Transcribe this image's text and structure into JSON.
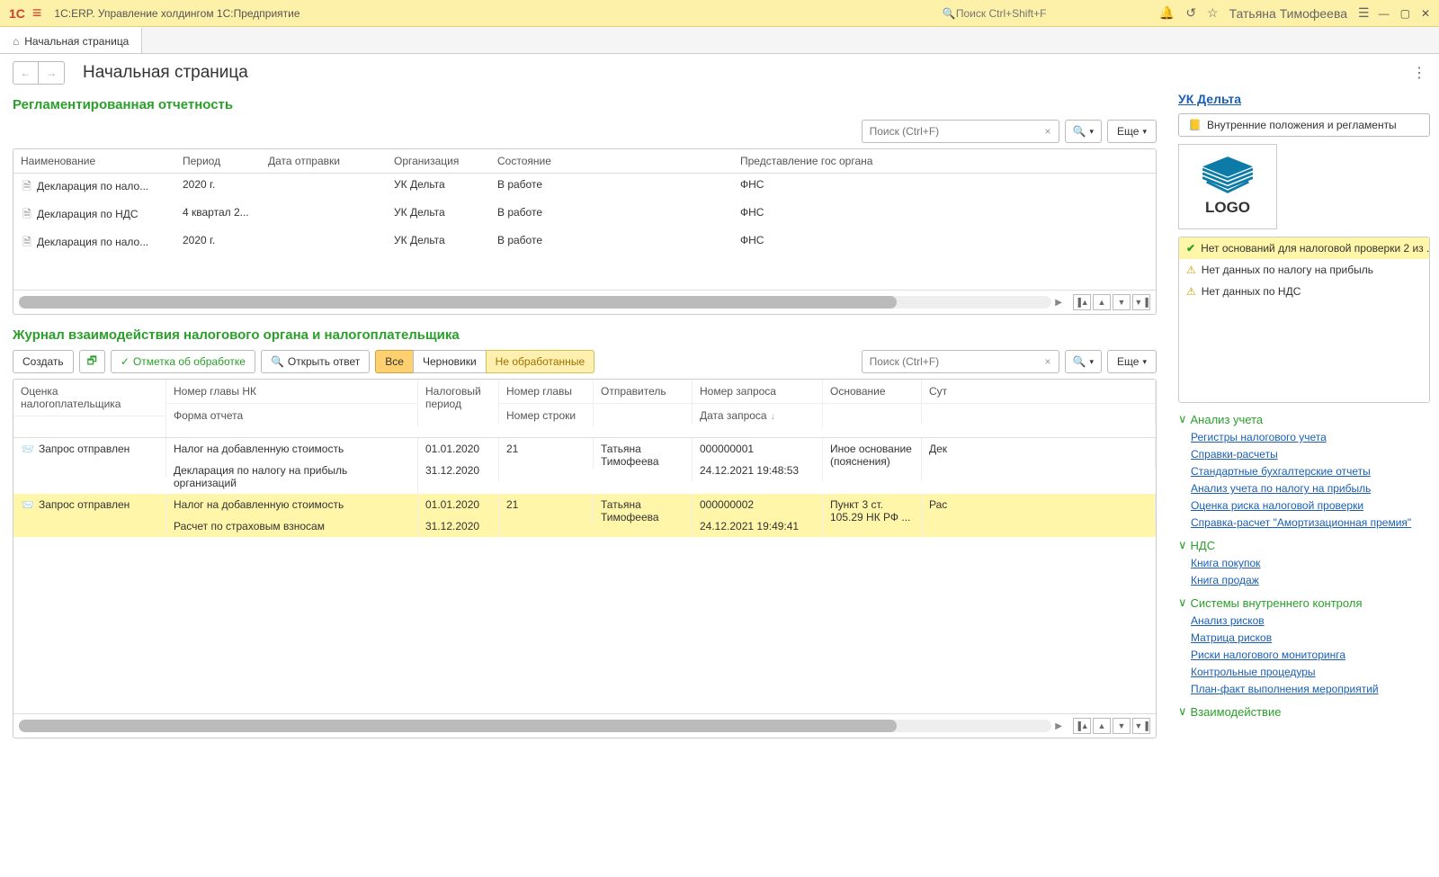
{
  "app": {
    "title": "1С:ERP. Управление холдингом 1С:Предприятие",
    "logo": "1С",
    "search_placeholder": "Поиск Ctrl+Shift+F",
    "user": "Татьяна Тимофеева"
  },
  "tab": {
    "home": "Начальная страница"
  },
  "page": {
    "title": "Начальная страница"
  },
  "section1": {
    "title": "Регламентированная отчетность",
    "search_placeholder": "Поиск (Ctrl+F)",
    "more": "Еще",
    "cols": {
      "name": "Наименование",
      "period": "Период",
      "sent": "Дата отправки",
      "org": "Организация",
      "status": "Состояние",
      "gov": "Представление гос органа"
    },
    "rows": [
      {
        "name": "Декларация по нало...",
        "period": "2020 г.",
        "org": "УК Дельта",
        "status": "В работе",
        "gov": "ФНС"
      },
      {
        "name": "Декларация по НДС",
        "period": "4 квартал 2...",
        "org": "УК Дельта",
        "status": "В работе",
        "gov": "ФНС"
      },
      {
        "name": "Декларация по нало...",
        "period": "2020 г.",
        "org": "УК Дельта",
        "status": "В работе",
        "gov": "ФНС"
      }
    ]
  },
  "section2": {
    "title": "Журнал взаимодействия налогового органа и налогоплательщика",
    "create": "Создать",
    "mark": "Отметка об обработке",
    "open_answer": "Открыть ответ",
    "filter_all": "Все",
    "filter_drafts": "Черновики",
    "filter_unprocessed": "Не обработанные",
    "search_placeholder": "Поиск (Ctrl+F)",
    "more": "Еще",
    "head": {
      "c1a": "Оценка налогоплательщика",
      "c2a": "Номер главы НК",
      "c2b": "Форма отчета",
      "c3a": "Налоговый период",
      "c4a": "Номер главы",
      "c4b": "Номер строки",
      "c5a": "Отправитель",
      "c6a": "Номер запроса",
      "c6b": "Дата запроса",
      "c7a": "Основание",
      "c8a": "Сут"
    },
    "rows": [
      {
        "c1": "Запрос отправлен",
        "c2a": "Налог на добавленную стоимость",
        "c2b": "Декларация по налогу на прибыль организаций",
        "c3a": "01.01.2020",
        "c3b": "31.12.2020",
        "c4a": "21",
        "c5a": "Татьяна Тимофеева",
        "c6a": "000000001",
        "c6b": "24.12.2021 19:48:53",
        "c7a": "Иное основание (пояснения)",
        "c8a": "Дек"
      },
      {
        "c1": "Запрос отправлен",
        "c2a": "Налог на добавленную стоимость",
        "c2b": "Расчет по страховым взносам",
        "c3a": "01.01.2020",
        "c3b": "31.12.2020",
        "c4a": "21",
        "c5a": "Татьяна Тимофеева",
        "c6a": "000000002",
        "c6b": "24.12.2021 19:49:41",
        "c7a": "Пункт 3 ст. 105.29 НК РФ ...",
        "c8a": "Рас"
      }
    ]
  },
  "side": {
    "company": "УК Дельта",
    "internal_docs": "Внутренние положения и регламенты",
    "logo_text": "LOGO",
    "msgs": [
      "Нет оснований для налоговой проверки 2 из ...",
      "Нет данных по налогу на прибыль",
      "Нет данных по НДС"
    ],
    "groups": [
      {
        "title": "Анализ учета",
        "links": [
          "Регистры налогового учета",
          "Справки-расчеты",
          "Стандартные бухгалтерские отчеты",
          "Анализ учета по налогу на прибыль",
          "Оценка риска налоговой проверки",
          "Справка-расчет \"Амортизационная премия\""
        ]
      },
      {
        "title": "НДС",
        "links": [
          "Книга покупок",
          "Книга продаж"
        ]
      },
      {
        "title": "Системы внутреннего контроля",
        "links": [
          "Анализ рисков",
          "Матрица рисков",
          "Риски налогового мониторинга",
          "Контрольные процедуры",
          "План-факт выполнения мероприятий"
        ]
      },
      {
        "title": "Взаимодействие",
        "links": []
      }
    ]
  }
}
